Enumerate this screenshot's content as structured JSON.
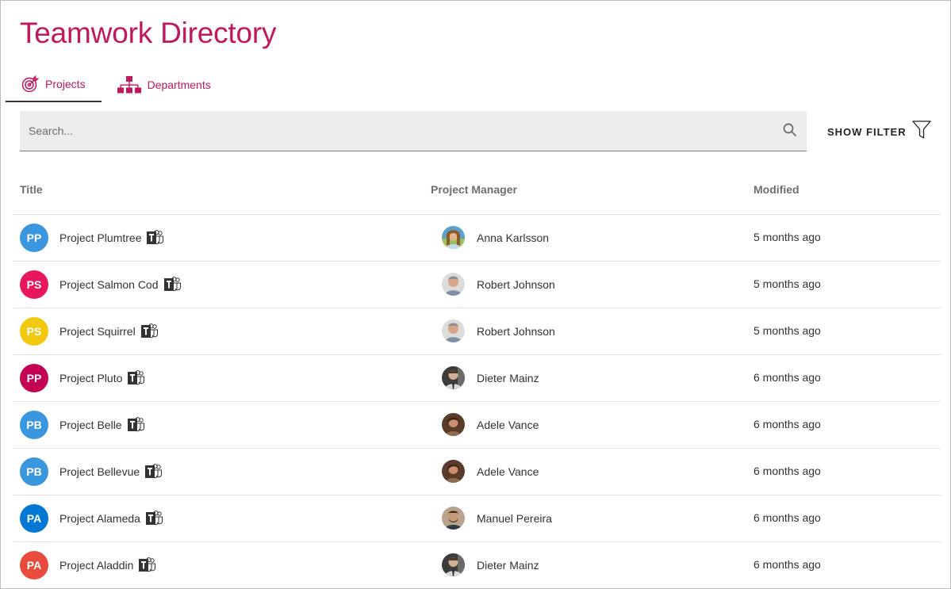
{
  "header": {
    "title": "Teamwork Directory"
  },
  "tabs": [
    {
      "label": "Projects",
      "icon": "target-icon",
      "active": true
    },
    {
      "label": "Departments",
      "icon": "org-chart-icon",
      "active": false
    }
  ],
  "search": {
    "placeholder": "Search...",
    "value": "",
    "icon": "search-icon"
  },
  "filter": {
    "label": "SHOW FILTER",
    "icon": "filter-icon"
  },
  "table": {
    "columns": [
      "Title",
      "Project Manager",
      "Modified"
    ],
    "rows": [
      {
        "initials": "PP",
        "color": "#3a96dd",
        "title": "Project Plumtree",
        "manager": "Anna Karlsson",
        "photo": "anna",
        "modified": "5 months ago"
      },
      {
        "initials": "PS",
        "color": "#e8175d",
        "title": "Project Salmon Cod",
        "manager": "Robert Johnson",
        "photo": "robert",
        "modified": "5 months ago"
      },
      {
        "initials": "PS",
        "color": "#f2c80f",
        "title": "Project Squirrel",
        "manager": "Robert Johnson",
        "photo": "robert",
        "modified": "5 months ago"
      },
      {
        "initials": "PP",
        "color": "#c30052",
        "title": "Project Pluto",
        "manager": "Dieter Mainz",
        "photo": "dieter",
        "modified": "6 months ago"
      },
      {
        "initials": "PB",
        "color": "#3a96dd",
        "title": "Project Belle",
        "manager": "Adele Vance",
        "photo": "adele",
        "modified": "6 months ago"
      },
      {
        "initials": "PB",
        "color": "#3a96dd",
        "title": "Project Bellevue",
        "manager": "Adele Vance",
        "photo": "adele",
        "modified": "6 months ago"
      },
      {
        "initials": "PA",
        "color": "#0078d4",
        "title": "Project Alameda",
        "manager": "Manuel Pereira",
        "photo": "manuel",
        "modified": "6 months ago"
      },
      {
        "initials": "PA",
        "color": "#e74c3c",
        "title": "Project Aladdin",
        "manager": "Dieter Mainz",
        "photo": "dieter",
        "modified": "6 months ago"
      }
    ]
  },
  "colors": {
    "accent": "#c0175d",
    "tab_underline": "#333333",
    "search_bg": "#ededed"
  }
}
